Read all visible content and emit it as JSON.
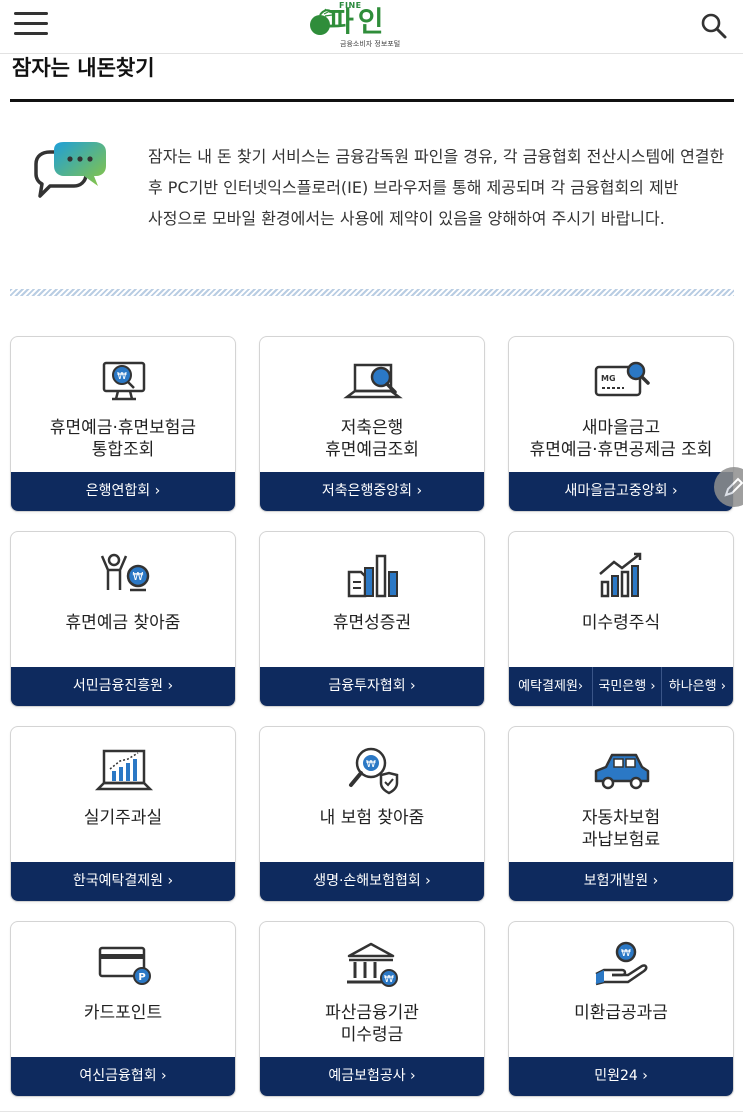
{
  "header": {
    "menu_icon": "hamburger-menu-icon",
    "logo_small": "FINE",
    "logo_word": "파인",
    "logo_sub": "금융소비자 정보포털",
    "search_icon": "search-icon"
  },
  "page": {
    "title": "잠자는 내돈찾기",
    "notice_icon": "speech-bubbles-icon",
    "notice": "잠자는 내 돈 찾기 서비스는 금융감독원 파인을 경유, 각 금융협회 전산시스템에 연결한 후 PC기반 인터넷익스플로러(IE) 브라우저를 통해 제공되며 각 금융협회의 제반 사정으로 모바일 환경에서는 사용에 제약이 있음을 양해하여 주시기 바랍니다."
  },
  "colors": {
    "navy": "#0e2a5e",
    "accent_blue": "#2b78c5",
    "brand_green": "#2f8d3a"
  },
  "cards": [
    {
      "label": "휴면예금·휴면보험금\n통합조회",
      "icon": "monitor-won-icon",
      "link": "은행연합회 ›"
    },
    {
      "label": "저축은행\n휴면예금조회",
      "icon": "laptop-search-icon",
      "link": "저축은행중앙회 ›"
    },
    {
      "label": "새마을금고\n휴면예금·휴면공제금 조회",
      "icon": "card-search-icon",
      "link": "새마을금고중앙회 ›"
    },
    {
      "label": "휴면예금 찾아줌",
      "icon": "person-coin-icon",
      "link": "서민금융진흥원 ›"
    },
    {
      "label": "휴면성증권",
      "icon": "document-chart-icon",
      "link": "금융투자협회 ›"
    },
    {
      "label": "미수령주식",
      "icon": "growth-chart-icon",
      "links": [
        "예탁결제원›",
        "국민은행 ›",
        "하나은행 ›"
      ]
    },
    {
      "label": "실기주과실",
      "icon": "board-chart-icon",
      "link": "한국예탁결제원 ›"
    },
    {
      "label": "내 보험 찾아줌",
      "icon": "magnifier-shield-icon",
      "link": "생명·손해보험협회 ›"
    },
    {
      "label": "자동차보험\n과납보험료",
      "icon": "car-icon",
      "link": "보험개발원 ›"
    },
    {
      "label": "카드포인트",
      "icon": "credit-card-point-icon",
      "link": "여신금융협회 ›"
    },
    {
      "label": "파산금융기관\n미수령금",
      "icon": "bank-building-icon",
      "link": "예금보험공사 ›"
    },
    {
      "label": "미환급공과금",
      "icon": "hand-coin-icon",
      "link": "민원24 ›"
    }
  ],
  "fab": {
    "icon": "pencil-icon"
  }
}
